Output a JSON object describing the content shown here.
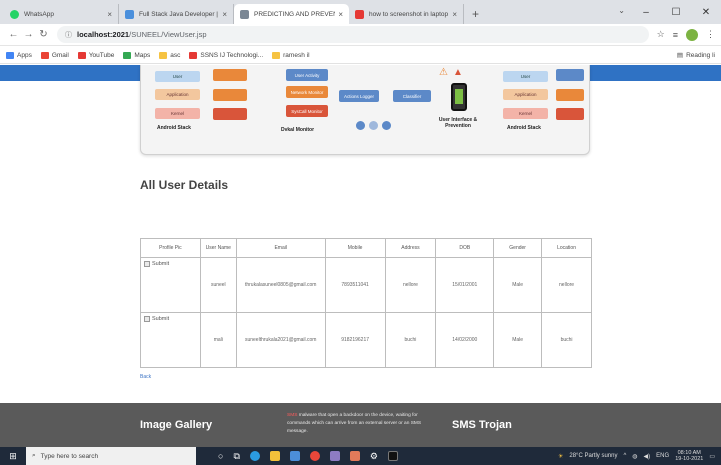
{
  "browser": {
    "tabs": [
      {
        "title": "WhatsApp",
        "color": "#25d366",
        "active": false
      },
      {
        "title": "Full Stack Java Developer | by M",
        "color": "#4a8fdc",
        "active": false
      },
      {
        "title": "PREDICTING AND PREVENTION",
        "color": "#7b8794",
        "active": true
      },
      {
        "title": "how to screenshot in laptop - Yo",
        "color": "#e53935",
        "active": false
      }
    ],
    "new_tab": "+",
    "address": {
      "host": "localhost:2021",
      "path": "/SUNEEL/ViewUser.jsp"
    },
    "bookmarks": [
      {
        "label": "Apps",
        "color": "#4285f4"
      },
      {
        "label": "Gmail",
        "color": "#ea4335"
      },
      {
        "label": "YouTube",
        "color": "#e53935"
      },
      {
        "label": "Maps",
        "color": "#34a853"
      },
      {
        "label": "asc",
        "color": "#f6c342"
      },
      {
        "label": "SSNS IJ Technologi...",
        "color": "#e53935"
      },
      {
        "label": "ramesh il",
        "color": "#f6c342"
      }
    ],
    "reading_list": "Reading li"
  },
  "diagram": {
    "left_stack": [
      "User",
      "Application",
      "Kernel"
    ],
    "left_caption": "Android Stack",
    "middle_boxes": [
      "User Activity",
      "Network Monitor",
      "Actions Logger",
      "Classifier",
      "SysCall Monitor"
    ],
    "middle_caption": "Dvkal Monitor",
    "ui_caption": "User Interface & Prevention",
    "right_stack": [
      "User",
      "Application",
      "Kernel"
    ],
    "right_caption": "Android Stack"
  },
  "section_title": "All User Details",
  "table": {
    "headers": [
      "Profile Pic",
      "User Name",
      "Email",
      "Mobile",
      "Address",
      "DOB",
      "Gender",
      "Location"
    ],
    "rows": [
      {
        "pic": "Submit",
        "name": "suneel",
        "email": "thrukalasuneel0805@gmail.com",
        "mobile": "7893511041",
        "address": "nellore",
        "dob": "15/01/2001",
        "gender": "Male",
        "location": "nellore"
      },
      {
        "pic": "Submit",
        "name": "mali",
        "email": "suneelthrukala2021@gmail.com",
        "mobile": "9182196217",
        "address": "buchi",
        "dob": "14/02/2000",
        "gender": "Male",
        "location": "buchi"
      }
    ]
  },
  "back_link": "Back",
  "footer": {
    "gallery_title": "Image Gallery",
    "text_red": "SMS",
    "text_rest": " malware that open a backdoor on the device, waiting for commands which can arrive from an external server or an SMS message.",
    "trojan_title": "SMS Trojan"
  },
  "taskbar": {
    "search_placeholder": "Type here to search",
    "weather": "28°C  Partly sunny",
    "lang": "ENG",
    "time": "08:10 AM",
    "date": "19-10-2021"
  }
}
